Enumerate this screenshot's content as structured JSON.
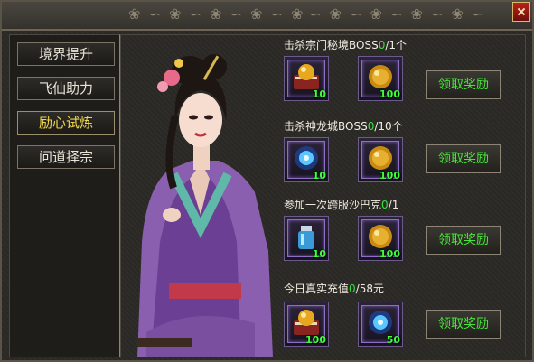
{
  "nav": {
    "items": [
      {
        "label": "境界提升",
        "active": false
      },
      {
        "label": "飞仙助力",
        "active": false
      },
      {
        "label": "励心试炼",
        "active": true
      },
      {
        "label": "问道择宗",
        "active": false
      }
    ]
  },
  "quests": [
    {
      "prefix": "击杀宗门秘境BOSS",
      "progress": "0",
      "suffix": "/1个",
      "rewards": [
        {
          "icon": "red-tome-gold-orb",
          "qty": "10"
        },
        {
          "icon": "gold-coin-orb",
          "qty": "100"
        }
      ],
      "claim_label": "领取奖励"
    },
    {
      "prefix": "击杀神龙城BOSS",
      "progress": "0",
      "suffix": "/10个",
      "rewards": [
        {
          "icon": "blue-energy-orb",
          "qty": "10"
        },
        {
          "icon": "gold-coin-orb",
          "qty": "100"
        }
      ],
      "claim_label": "领取奖励"
    },
    {
      "prefix": "参加一次跨服沙巴克",
      "progress": "0",
      "suffix": "/1",
      "rewards": [
        {
          "icon": "blue-potion-jar",
          "qty": "10"
        },
        {
          "icon": "gold-coin-orb",
          "qty": "100"
        }
      ],
      "claim_label": "领取奖励"
    },
    {
      "prefix": "今日真实充值",
      "progress": "0",
      "suffix": "/58元",
      "rewards": [
        {
          "icon": "red-tome-gold-orb",
          "qty": "100"
        },
        {
          "icon": "blue-energy-orb",
          "qty": "50"
        }
      ],
      "claim_label": "领取奖励"
    }
  ],
  "colors": {
    "active_tab": "#f0d64a",
    "progress": "#39e33d",
    "claim_text": "#47e53a",
    "quantity": "#3cff3a"
  }
}
